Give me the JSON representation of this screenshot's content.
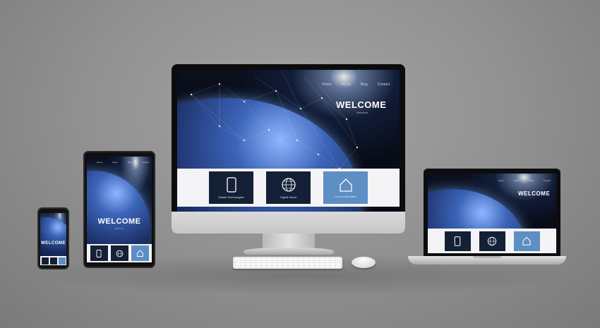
{
  "site": {
    "nav": [
      "Home",
      "About",
      "Blog",
      "Contact"
    ],
    "welcome": "WELCOME",
    "subtitle": "Welcome",
    "services": [
      {
        "label": "Mobile Technologies",
        "icon": "smartphone-icon"
      },
      {
        "label": "Digital World",
        "icon": "globe-icon"
      },
      {
        "label": "Home Automation",
        "icon": "house-icon"
      }
    ]
  },
  "colors": {
    "tile_dark": "#142036",
    "tile_light": "#5d8ec4",
    "background": "#9a9a9a"
  }
}
